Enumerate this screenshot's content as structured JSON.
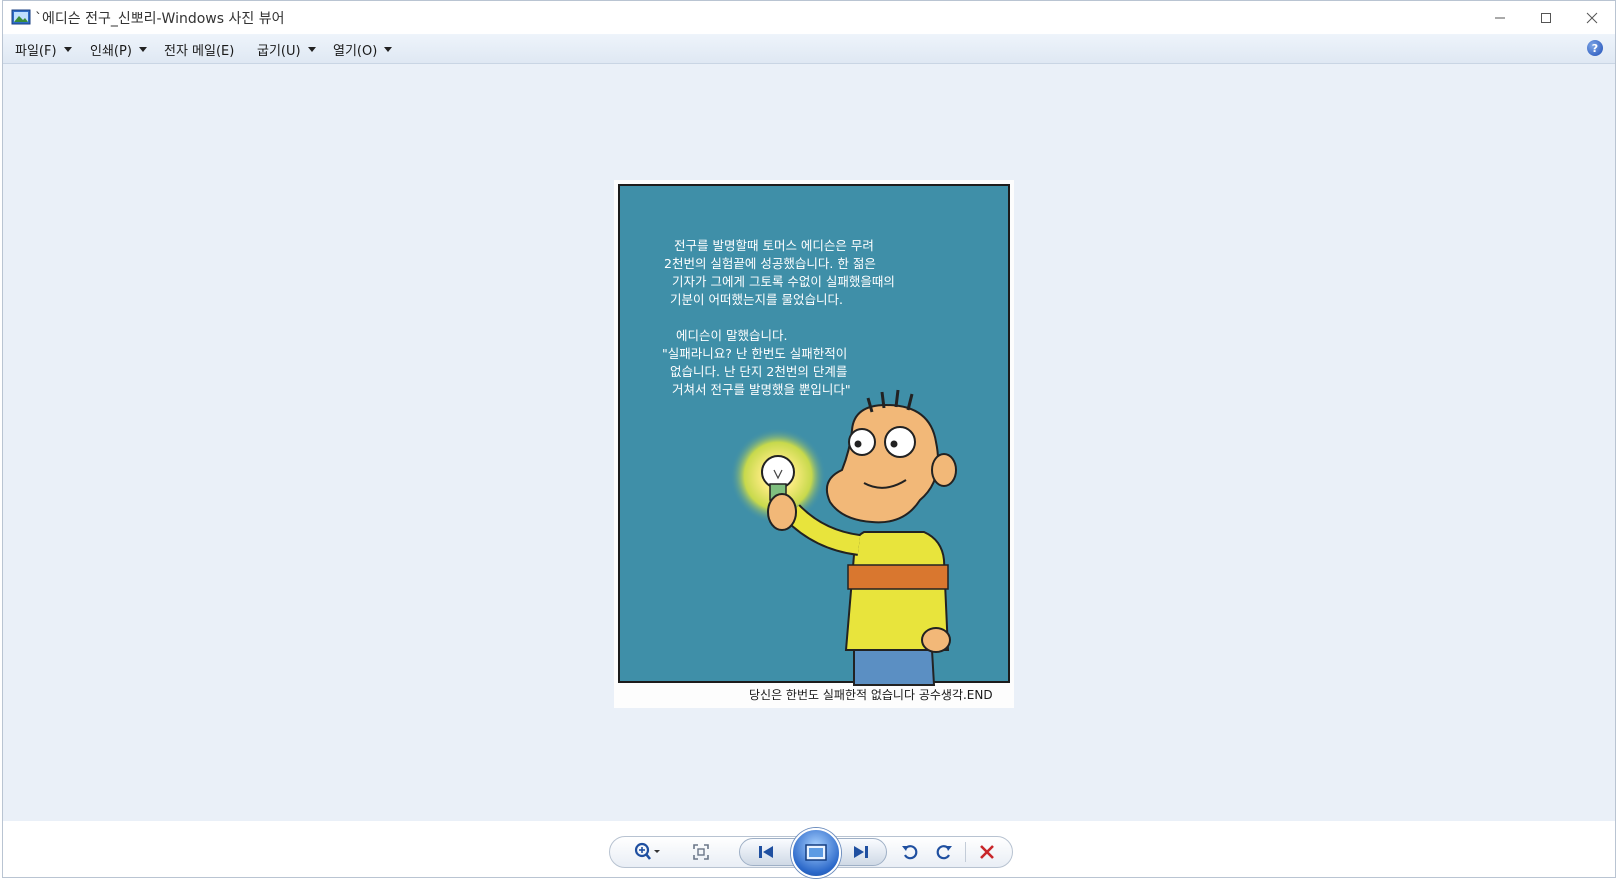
{
  "window": {
    "title": "`에디슨 전구_신뽀리-Windows 사진 뷰어",
    "app_icon": "photo-viewer-icon",
    "controls": [
      "minimize-icon",
      "maximize-icon",
      "close-icon"
    ]
  },
  "menu": {
    "file": "파일(F)",
    "print": "인쇄(P)",
    "email": "전자 메일(E)",
    "burn": "굽기(U)",
    "open": "열기(O)",
    "help_icon": "help-icon"
  },
  "comic": {
    "paragraph1": [
      "전구를 발명할때 토머스 에디슨은 무려",
      "2천번의 실험끝에 성공했습니다. 한 젊은",
      "기자가 그에게 그토록 수없이 실패했을때의",
      "기분이 어떠했는지를 물었습니다."
    ],
    "paragraph2": [
      "에디슨이 말했습니다.",
      "\"실패라니요? 난 한번도 실패한적이",
      "없습니다. 난 단지 2천번의 단계를",
      "거쳐서 전구를 발명했을 뿐입니다\""
    ],
    "caption": "당신은 한번도 실패한적 없습니다 공수생각.END",
    "colors": {
      "background": "#3f8fa8",
      "shirt": "#e8e43c",
      "belt": "#d9772f",
      "skin": "#f2b878",
      "glow": "#f4e060",
      "pants": "#5b8fc3"
    }
  },
  "toolbar": {
    "zoom_icon": "zoom-icon",
    "fit_icon": "actual-size-icon",
    "prev_icon": "previous-icon",
    "slideshow_icon": "slideshow-icon",
    "next_icon": "next-icon",
    "rotate_ccw_icon": "rotate-counterclockwise-icon",
    "rotate_cw_icon": "rotate-clockwise-icon",
    "delete_icon": "delete-icon"
  }
}
